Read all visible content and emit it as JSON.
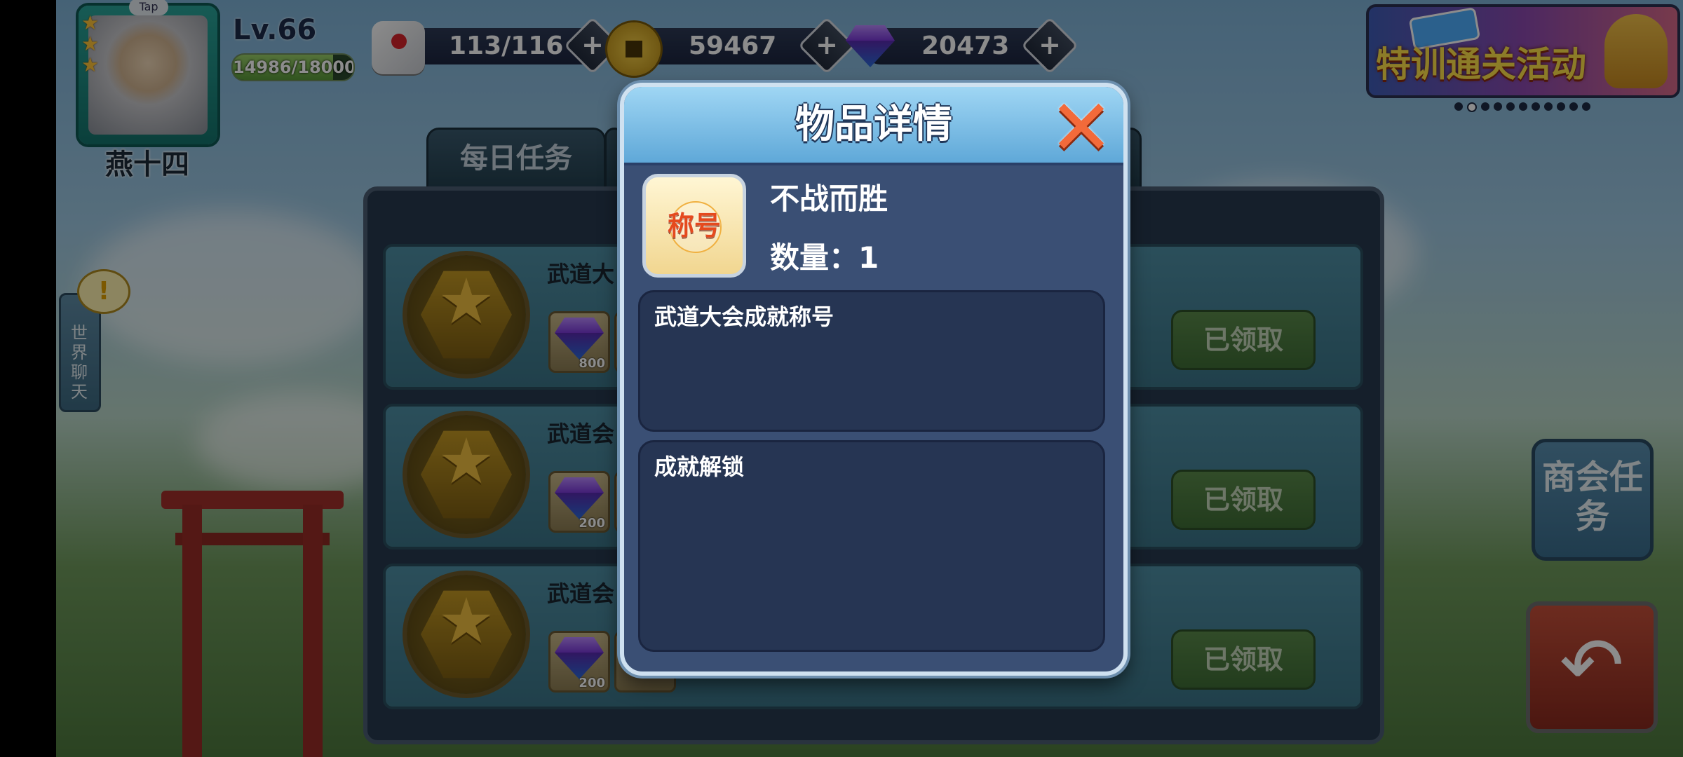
{
  "player": {
    "name": "燕十四",
    "level": "Lv.66",
    "exp": "14986/18000",
    "exp_fraction": 0.8326,
    "stars": 3,
    "tap_label": "Tap"
  },
  "resources": {
    "stamina": "113/116",
    "gold": "59467",
    "diamonds": "20473",
    "plus": "+"
  },
  "event": {
    "banner_text": "特训通关活动",
    "page_count": 11,
    "active_page": 1
  },
  "tabs": [
    {
      "label": "每日任务"
    }
  ],
  "tasks": [
    {
      "title": "武道大",
      "reward_count": "800",
      "status": "已领取"
    },
    {
      "title": "武道会",
      "reward_count": "200",
      "status": "已领取"
    },
    {
      "title": "武道会",
      "reward_count": "200",
      "status": "已领取"
    }
  ],
  "side": {
    "chat": "世界聊天",
    "alert": "!",
    "guild_task": "商会任务"
  },
  "modal": {
    "title": "物品详情",
    "item_icon_text": "称号",
    "item_name": "不战而胜",
    "quantity": "数量：1",
    "description": "武道大会成就称号",
    "source": "成就解锁"
  },
  "colors": {
    "modal_bg": "#3a4f74",
    "modal_header": "#5fa8d8",
    "close_red": "#f36a3a",
    "claimed_green": "#4f7f42"
  }
}
